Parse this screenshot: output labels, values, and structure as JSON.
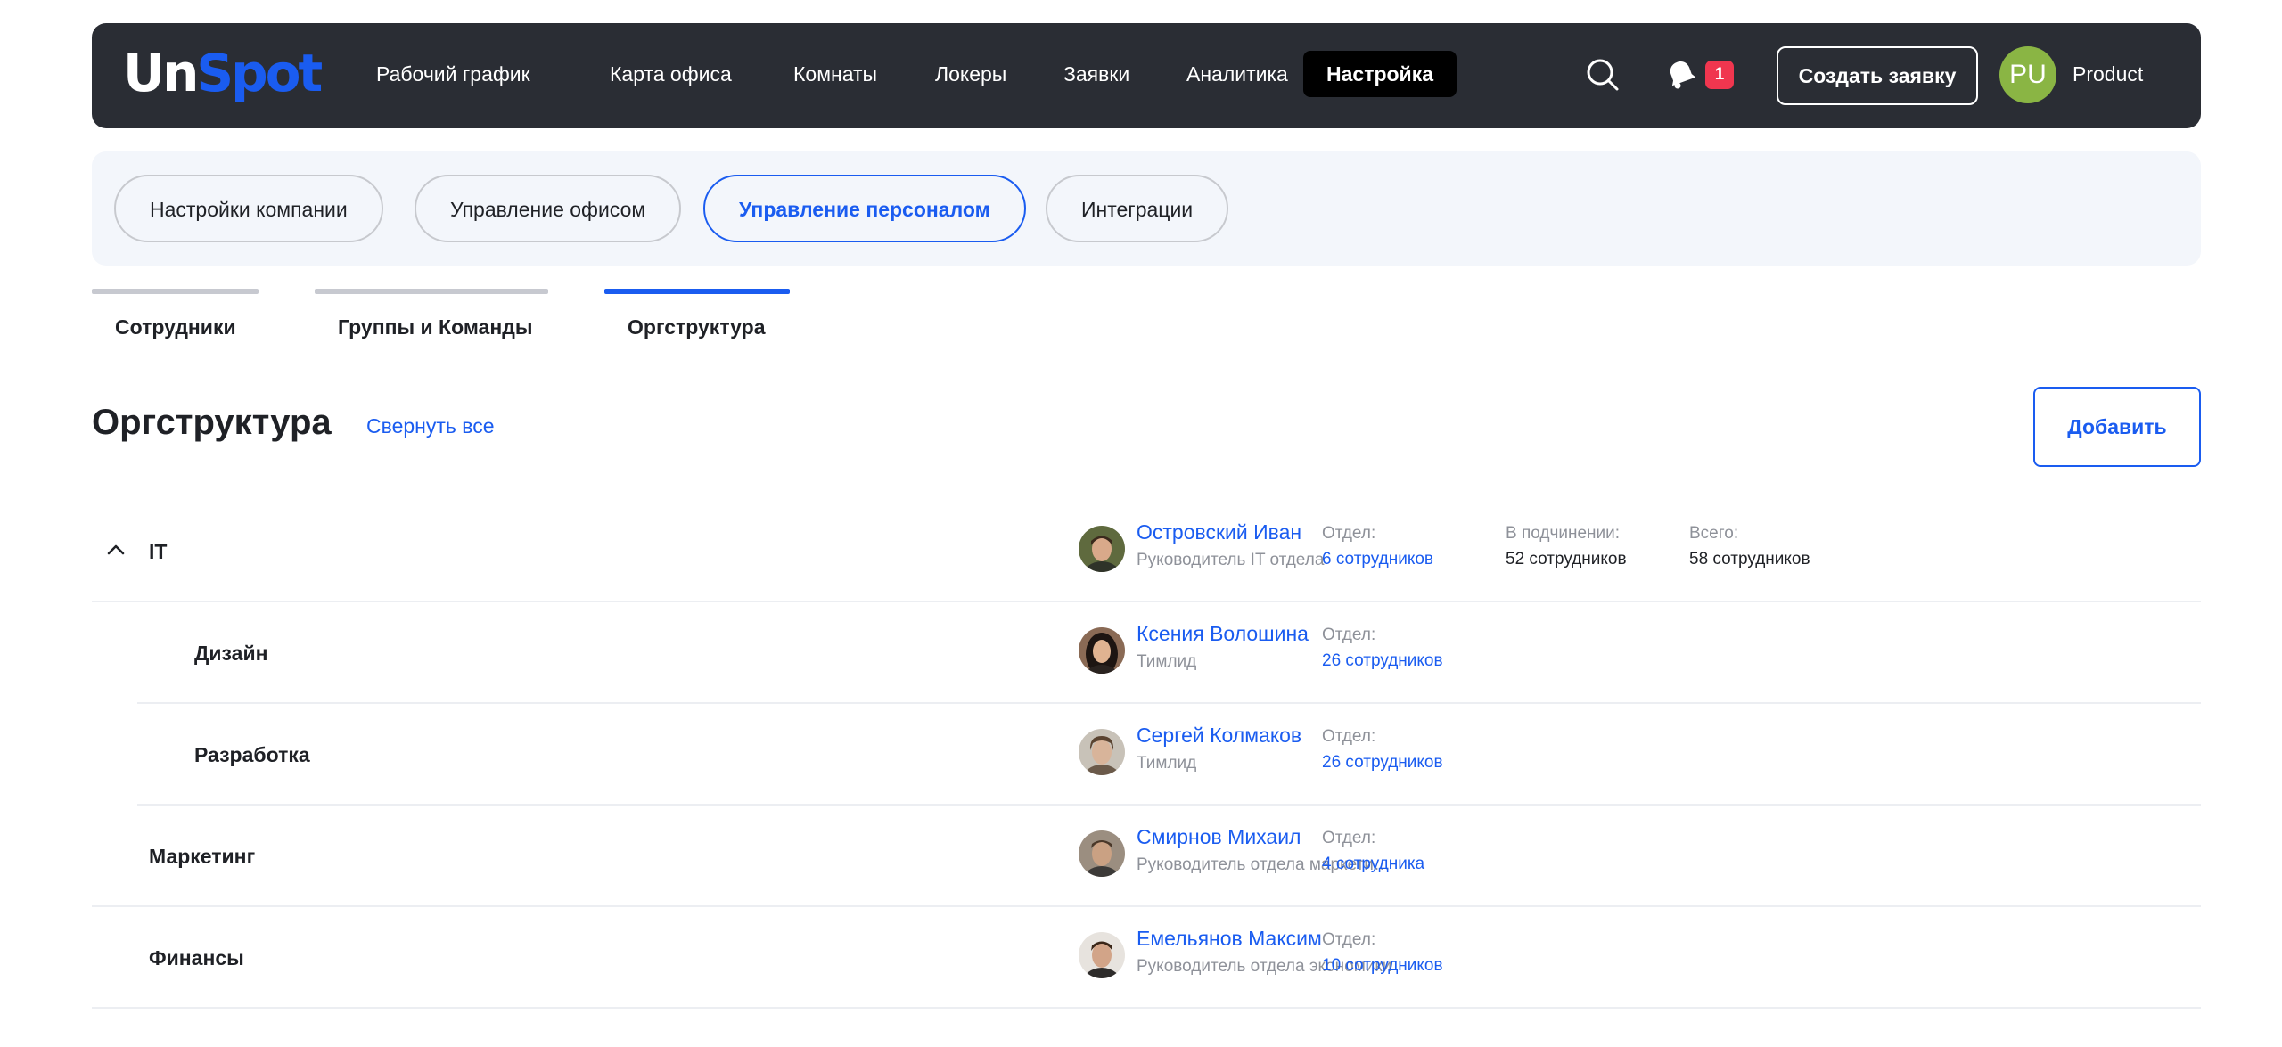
{
  "header": {
    "logo_un": "Un",
    "logo_spot": "Spot",
    "nav": [
      {
        "label": "Рабочий график"
      },
      {
        "label": "Карта офиса"
      },
      {
        "label": "Комнаты"
      },
      {
        "label": "Локеры"
      },
      {
        "label": "Заявки"
      },
      {
        "label": "Аналитика"
      },
      {
        "label": "Настройка"
      }
    ],
    "notifications_count": "1",
    "create_request_label": "Создать заявку",
    "user_initials": "PU",
    "user_name": "Product"
  },
  "settings_tabs": [
    {
      "label": "Настройки компании"
    },
    {
      "label": "Управление офисом"
    },
    {
      "label": "Управление персоналом"
    },
    {
      "label": "Интеграции"
    }
  ],
  "page_tabs": [
    {
      "label": "Сотрудники"
    },
    {
      "label": "Группы и Команды"
    },
    {
      "label": "Оргструктура"
    }
  ],
  "page": {
    "title": "Оргструктура",
    "collapse_all": "Свернуть все",
    "add_label": "Добавить"
  },
  "colors": {
    "accent": "#1a5cf0",
    "topbar": "#2a2d34",
    "badge": "#f0364f",
    "avatar": "#8ab544"
  },
  "org": {
    "rows": [
      {
        "name": "IT",
        "manager": "Островский Иван",
        "role": "Руководитель IT отдела",
        "dept_label": "Отдел:",
        "dept_value": "6 сотрудников",
        "sub_label": "В подчинении:",
        "sub_value": "52 сотрудников",
        "total_label": "Всего:",
        "total_value": "58 сотрудников"
      },
      {
        "name": "Дизайн",
        "manager": "Ксения Волошина",
        "role": "Тимлид",
        "dept_label": "Отдел:",
        "dept_value": "26 сотрудников"
      },
      {
        "name": "Разработка",
        "manager": "Сергей Колмаков",
        "role": "Тимлид",
        "dept_label": "Отдел:",
        "dept_value": "26 сотрудников"
      },
      {
        "name": "Маркетинг",
        "manager": "Смирнов Михаил",
        "role": "Руководитель отдела маркетинга",
        "dept_label": "Отдел:",
        "dept_value": "4 сотрудника"
      },
      {
        "name": "Финансы",
        "manager": "Емельянов Максим",
        "role": "Руководитель отдела экономики",
        "dept_label": "Отдел:",
        "dept_value": "10 сотрудников"
      }
    ]
  }
}
